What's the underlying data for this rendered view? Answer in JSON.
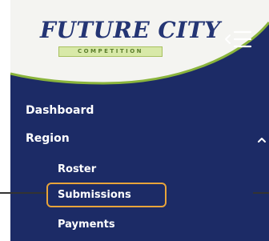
{
  "logo": {
    "name": "FUTURE CITY",
    "subtitle": "COMPETITION"
  },
  "nav": {
    "dashboard": "Dashboard",
    "region": "Region",
    "roster": "Roster",
    "submissions": "Submissions",
    "payments": "Payments"
  },
  "colors": {
    "sidebar_bg": "#1c2b66",
    "highlight": "#e8a43a",
    "text": "#ffffff"
  },
  "icons": {
    "menu_toggle": "collapse-menu-icon",
    "region_expand": "chevron-up-icon"
  }
}
